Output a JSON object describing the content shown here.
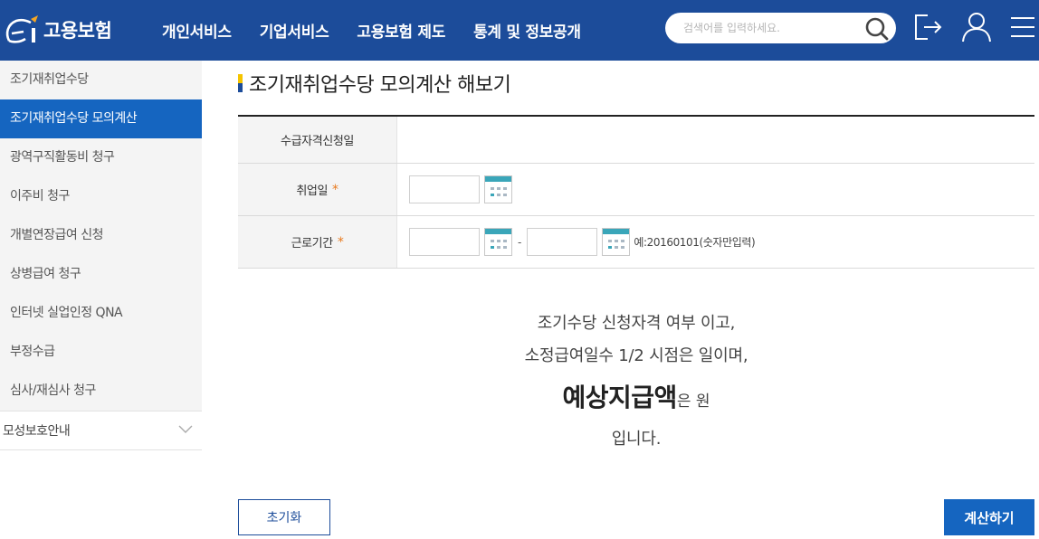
{
  "header": {
    "logo_text": "고용보험",
    "nav": [
      {
        "label": "개인서비스"
      },
      {
        "label": "기업서비스"
      },
      {
        "label": "고용보험 제도"
      },
      {
        "label": "통계 및 정보공개"
      }
    ],
    "search": {
      "placeholder": "검색어를 입력하세요.",
      "value": ""
    },
    "icons": [
      "logout-icon",
      "user-icon",
      "menu-icon"
    ],
    "bg_color": "#1c4c9a"
  },
  "sidebar": {
    "items": [
      {
        "label": "조기재취업수당",
        "active": false
      },
      {
        "label": "조기재취업수당 모의계산",
        "active": true
      },
      {
        "label": "광역구직활동비 청구",
        "active": false
      },
      {
        "label": "이주비 청구",
        "active": false
      },
      {
        "label": "개별연장급여 신청",
        "active": false
      },
      {
        "label": "상병급여 청구",
        "active": false
      },
      {
        "label": "인터넷 실업인정 QNA",
        "active": false
      },
      {
        "label": "부정수급",
        "active": false
      },
      {
        "label": "심사/재심사 청구",
        "active": false
      }
    ],
    "group": {
      "label": "모성보호안내"
    },
    "active_color": "#1565c0"
  },
  "main": {
    "title": "조기재취업수당 모의계산 해보기",
    "form": {
      "rows": [
        {
          "label": "수급자격신청일",
          "required": false
        },
        {
          "label": "취업일",
          "required": true,
          "required_mark": "*"
        },
        {
          "label": "근로기간",
          "required": true,
          "required_mark": "*"
        }
      ],
      "separator": "-",
      "hint": "예:20160101(숫자만입력)"
    },
    "result": {
      "line1": "조기수당 신청자격 여부 이고,",
      "line2": "소정급여일수 1/2 시점은 일이며,",
      "amount_label": "예상지급액",
      "amount_suffix": "은 원",
      "line4": "입니다."
    },
    "buttons": {
      "reset": "초기화",
      "calculate": "계산하기"
    }
  }
}
